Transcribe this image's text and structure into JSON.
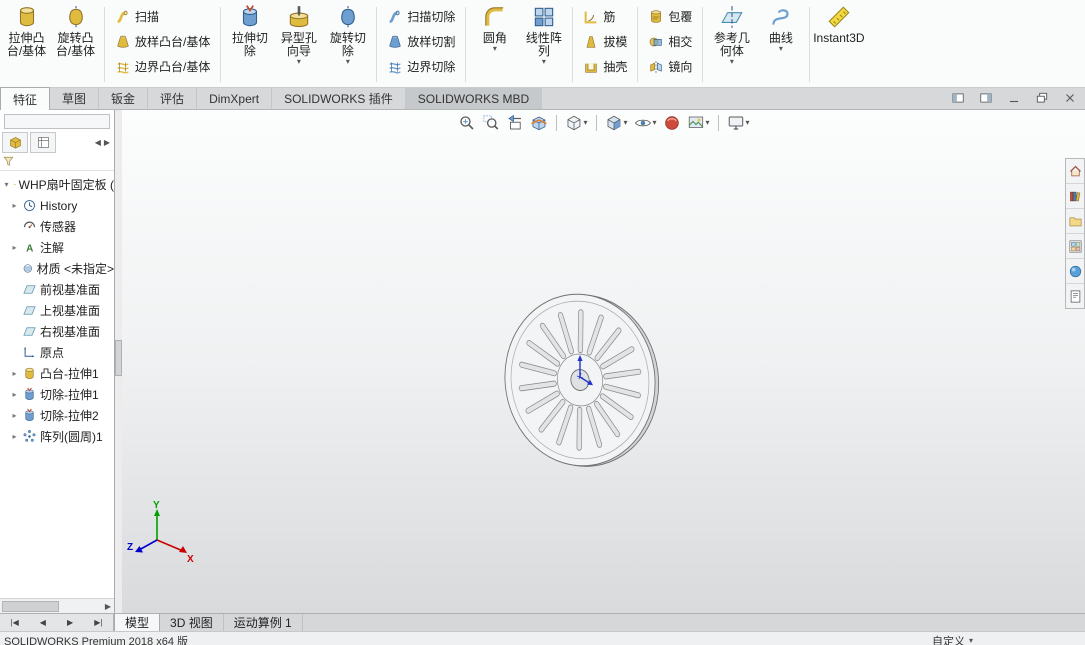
{
  "ribbon": {
    "groups": [
      {
        "buttons": [
          {
            "kind": "large",
            "label": "拉伸凸台/基体",
            "lines": [
              "拉伸凸",
              "台/基体"
            ],
            "icon": "extrude-boss-icon",
            "dropdown": false
          },
          {
            "kind": "large",
            "label": "旋转凸台/基体",
            "lines": [
              "旋转凸",
              "台/基体"
            ],
            "icon": "revolve-boss-icon",
            "dropdown": false
          }
        ]
      },
      {
        "buttons": [
          {
            "kind": "small",
            "label": "扫描",
            "icon": "sweep-icon"
          },
          {
            "kind": "small",
            "label": "放样凸台/基体",
            "icon": "loft-icon"
          },
          {
            "kind": "small",
            "label": "边界凸台/基体",
            "icon": "boundary-icon"
          }
        ]
      },
      {
        "buttons": [
          {
            "kind": "large",
            "label": "拉伸切除",
            "lines": [
              "拉伸切",
              "除"
            ],
            "icon": "extrude-cut-icon",
            "dropdown": false
          },
          {
            "kind": "large",
            "label": "异型孔向导",
            "lines": [
              "异型孔",
              "向导"
            ],
            "icon": "hole-wizard-icon",
            "dropdown": true
          },
          {
            "kind": "large",
            "label": "旋转切除",
            "lines": [
              "旋转切",
              "除"
            ],
            "icon": "revolve-cut-icon",
            "dropdown": true
          }
        ]
      },
      {
        "buttons": [
          {
            "kind": "small",
            "label": "扫描切除",
            "icon": "sweep-cut-icon"
          },
          {
            "kind": "small",
            "label": "放样切割",
            "icon": "loft-cut-icon"
          },
          {
            "kind": "small",
            "label": "边界切除",
            "icon": "boundary-cut-icon"
          }
        ]
      },
      {
        "buttons": [
          {
            "kind": "large",
            "label": "圆角",
            "lines": [
              "圆角"
            ],
            "icon": "fillet-icon",
            "dropdown": true
          },
          {
            "kind": "large",
            "label": "线性阵列",
            "lines": [
              "线性阵",
              "列"
            ],
            "icon": "linear-pattern-icon",
            "dropdown": true
          }
        ]
      },
      {
        "buttons": [
          {
            "kind": "small",
            "label": "筋",
            "icon": "rib-icon"
          },
          {
            "kind": "small",
            "label": "拔模",
            "icon": "draft-icon"
          },
          {
            "kind": "small",
            "label": "抽壳",
            "icon": "shell-icon"
          }
        ]
      },
      {
        "buttons": [
          {
            "kind": "small",
            "label": "包覆",
            "icon": "wrap-icon"
          },
          {
            "kind": "small",
            "label": "相交",
            "icon": "intersect-icon"
          },
          {
            "kind": "small",
            "label": "镜向",
            "icon": "mirror-icon"
          }
        ]
      },
      {
        "buttons": [
          {
            "kind": "large",
            "label": "参考几何体",
            "lines": [
              "参考几",
              "何体"
            ],
            "icon": "reference-geometry-icon",
            "dropdown": true
          },
          {
            "kind": "large",
            "label": "曲线",
            "lines": [
              "曲线"
            ],
            "icon": "curves-icon",
            "dropdown": true
          }
        ]
      },
      {
        "buttons": [
          {
            "kind": "large",
            "label": "Instant3D",
            "lines": [
              "Instant3D"
            ],
            "icon": "instant3d-icon",
            "dropdown": false
          }
        ]
      }
    ]
  },
  "command_tabs": {
    "items": [
      {
        "name": "features",
        "label": "特征",
        "active": true
      },
      {
        "name": "sketch",
        "label": "草图"
      },
      {
        "name": "sheet-metal",
        "label": "钣金"
      },
      {
        "name": "evaluate",
        "label": "评估"
      },
      {
        "name": "dimxpert",
        "label": "DimXpert"
      },
      {
        "name": "addins",
        "label": "SOLIDWORKS 插件"
      },
      {
        "name": "mbd",
        "label": "SOLIDWORKS MBD",
        "shaded": true
      }
    ]
  },
  "window_controls": {
    "items": [
      {
        "name": "pane-left"
      },
      {
        "name": "pane-right"
      },
      {
        "name": "minimize"
      },
      {
        "name": "restore"
      },
      {
        "name": "close"
      }
    ]
  },
  "feature_tree": {
    "toolbar": {
      "buttons": [
        {
          "name": "featuremanager-tree",
          "icon": "part-icon"
        },
        {
          "name": "display-pane",
          "icon": "display-pane-icon"
        }
      ],
      "nav_arrows": [
        "◀",
        "▶"
      ]
    },
    "items": [
      {
        "name": "part-root",
        "label": "WHP扇叶固定板 (",
        "icon": "part-icon",
        "expander": "▾",
        "indent": 0
      },
      {
        "name": "history",
        "label": "History",
        "icon": "history-icon",
        "expander": "▸",
        "indent": 1
      },
      {
        "name": "sensors",
        "label": "传感器",
        "icon": "sensors-icon",
        "expander": "",
        "indent": 1
      },
      {
        "name": "annotations",
        "label": "注解",
        "icon": "annotations-icon",
        "expander": "▸",
        "indent": 1
      },
      {
        "name": "material",
        "label": "材质 <未指定>",
        "icon": "material-icon",
        "expander": "",
        "indent": 1
      },
      {
        "name": "front-plane",
        "label": "前视基准面",
        "icon": "plane-icon",
        "expander": "",
        "indent": 1
      },
      {
        "name": "top-plane",
        "label": "上视基准面",
        "icon": "plane-icon",
        "expander": "",
        "indent": 1
      },
      {
        "name": "right-plane",
        "label": "右视基准面",
        "icon": "plane-icon",
        "expander": "",
        "indent": 1
      },
      {
        "name": "origin",
        "label": "原点",
        "icon": "origin-icon",
        "expander": "",
        "indent": 1
      },
      {
        "name": "boss-extrude1",
        "label": "凸台-拉伸1",
        "icon": "boss-extrude-icon",
        "expander": "▸",
        "indent": 1
      },
      {
        "name": "cut-extrude1",
        "label": "切除-拉伸1",
        "icon": "cut-extrude-icon",
        "expander": "▸",
        "indent": 1
      },
      {
        "name": "cut-extrude2",
        "label": "切除-拉伸2",
        "icon": "cut-extrude-icon",
        "expander": "▸",
        "indent": 1
      },
      {
        "name": "circular-pattern1",
        "label": "阵列(圆周)1",
        "icon": "circular-pattern-icon",
        "expander": "▸",
        "indent": 1
      }
    ]
  },
  "headsup": {
    "items": [
      {
        "name": "zoom-fit",
        "icon": "zoom-fit-icon"
      },
      {
        "name": "zoom-area",
        "icon": "zoom-area-icon"
      },
      {
        "name": "previous-view",
        "icon": "previous-view-icon"
      },
      {
        "name": "section-view",
        "icon": "section-view-icon"
      },
      {
        "sep": true
      },
      {
        "name": "view-orientation",
        "icon": "view-orientation-icon",
        "caret": true
      },
      {
        "sep": true
      },
      {
        "name": "display-style",
        "icon": "display-style-icon",
        "caret": true
      },
      {
        "name": "hide-show-items",
        "icon": "hide-show-items-icon",
        "caret": true
      },
      {
        "name": "edit-appearance",
        "icon": "edit-appearance-icon"
      },
      {
        "name": "apply-scene",
        "icon": "apply-scene-icon",
        "caret": true
      },
      {
        "sep": true
      },
      {
        "name": "view-settings",
        "icon": "view-settings-icon",
        "caret": true
      }
    ]
  },
  "task_pane": {
    "items": [
      {
        "name": "resources",
        "icon": "home-icon"
      },
      {
        "name": "design-library",
        "icon": "design-library-icon"
      },
      {
        "name": "file-explorer",
        "icon": "file-explorer-icon"
      },
      {
        "name": "view-palette",
        "icon": "view-palette-icon"
      },
      {
        "name": "appearances",
        "icon": "appearances-icon"
      },
      {
        "name": "custom-properties",
        "icon": "custom-properties-icon"
      }
    ]
  },
  "viewport": {
    "model_name": "WHP扇叶固定板",
    "slot_count": 18,
    "triad": {
      "x": "X",
      "y": "Y",
      "z": "Z"
    }
  },
  "bottom_tabs": {
    "nav_icons": [
      "first",
      "previous",
      "next",
      "last"
    ],
    "items": [
      {
        "name": "model",
        "label": "模型",
        "active": true
      },
      {
        "name": "3d-views",
        "label": "3D 视图"
      },
      {
        "name": "motion-study-1",
        "label": "运动算例 1"
      }
    ]
  },
  "status_bar": {
    "left": "SOLIDWORKS Premium 2018 x64 版",
    "right_label": "自定义"
  }
}
